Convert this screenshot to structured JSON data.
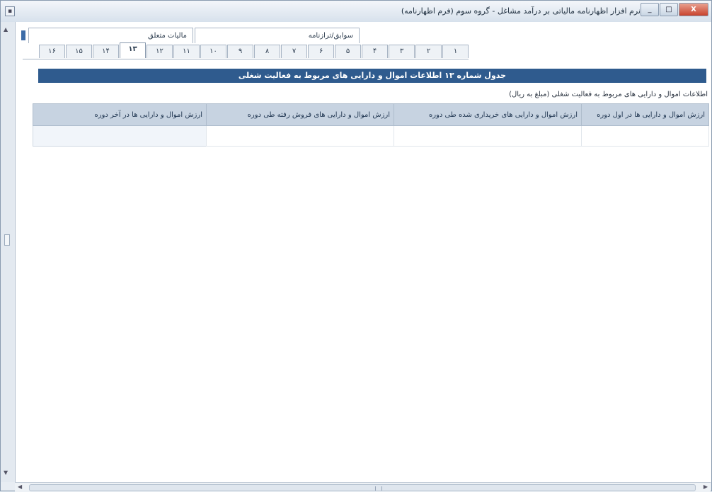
{
  "window": {
    "title": "نرم افزار اظهارنامه مالیاتی بر درآمد مشاغل - گروه سوم (فرم اظهارنامه)",
    "system_icon": "app-icon",
    "minimize_label": "_",
    "maximize_label": "□",
    "close_label": "X"
  },
  "top_tabs": [
    {
      "label": "سوابق/ترازنامه"
    },
    {
      "label": "مالیات متعلق"
    }
  ],
  "section_tabs": [
    {
      "label": "۱"
    },
    {
      "label": "۲"
    },
    {
      "label": "۳"
    },
    {
      "label": "۴"
    },
    {
      "label": "۵"
    },
    {
      "label": "۶"
    },
    {
      "label": "۷"
    },
    {
      "label": "۸"
    },
    {
      "label": "۹"
    },
    {
      "label": "۱۰"
    },
    {
      "label": "۱۱"
    },
    {
      "label": "۱۲"
    },
    {
      "label": "۱۳"
    },
    {
      "label": "۱۴"
    },
    {
      "label": "۱۵"
    },
    {
      "label": "۱۶"
    }
  ],
  "active_tab_index": 12,
  "banner_title": "جدول شماره ۱۳ اطلاعات اموال و دارایی های مربوط به فعالیت شغلی",
  "description": "اطلاعات اموال و دارایی های مربوط به فعالیت شغلی (مبلغ به ریال)",
  "table": {
    "headers": [
      "ارزش اموال و دارایی ها در اول دوره",
      "ارزش اموال و دارایی های خریداری شده طی دوره",
      "ارزش اموال و دارایی های فروش رفته طی دوره",
      "ارزش اموال و دارایی ها در آخر دوره"
    ]
  },
  "colors": {
    "banner_bg": "#2f5b8e",
    "header_bg": "#c7d3e1",
    "window_bg": "#e8edf3"
  }
}
